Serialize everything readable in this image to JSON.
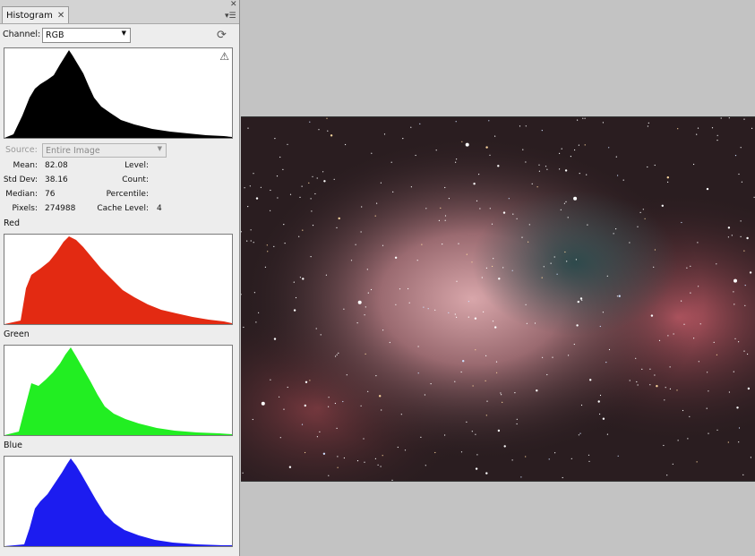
{
  "panel": {
    "tab_title": "Histogram",
    "tab_close_icon": "close-icon",
    "header_icons": [
      "panel-close-icon",
      "panel-menu-icon"
    ],
    "channel_label": "Channel:",
    "channel_value": "RGB",
    "refresh_icon": "refresh-icon",
    "warning_icon": "warning-icon",
    "source_label": "Source:",
    "source_value": "Entire Image",
    "stats": {
      "mean_label": "Mean:",
      "mean": "82.08",
      "stddev_label": "Std Dev:",
      "stddev": "38.16",
      "median_label": "Median:",
      "median": "76",
      "pixels_label": "Pixels:",
      "pixels": "274988",
      "level_label": "Level:",
      "level": "",
      "count_label": "Count:",
      "count": "",
      "percentile_label": "Percentile:",
      "percentile": "",
      "cache_label": "Cache Level:",
      "cache": "4"
    },
    "channels": [
      {
        "label": "",
        "color": "#000000"
      },
      {
        "label": "Red",
        "color": "#e32a12"
      },
      {
        "label": "Green",
        "color": "#22ee22"
      },
      {
        "label": "Blue",
        "color": "#1c1cf0"
      }
    ]
  },
  "colors": {
    "panel_bg": "#ededed",
    "workspace_bg": "#c3c3c3"
  }
}
